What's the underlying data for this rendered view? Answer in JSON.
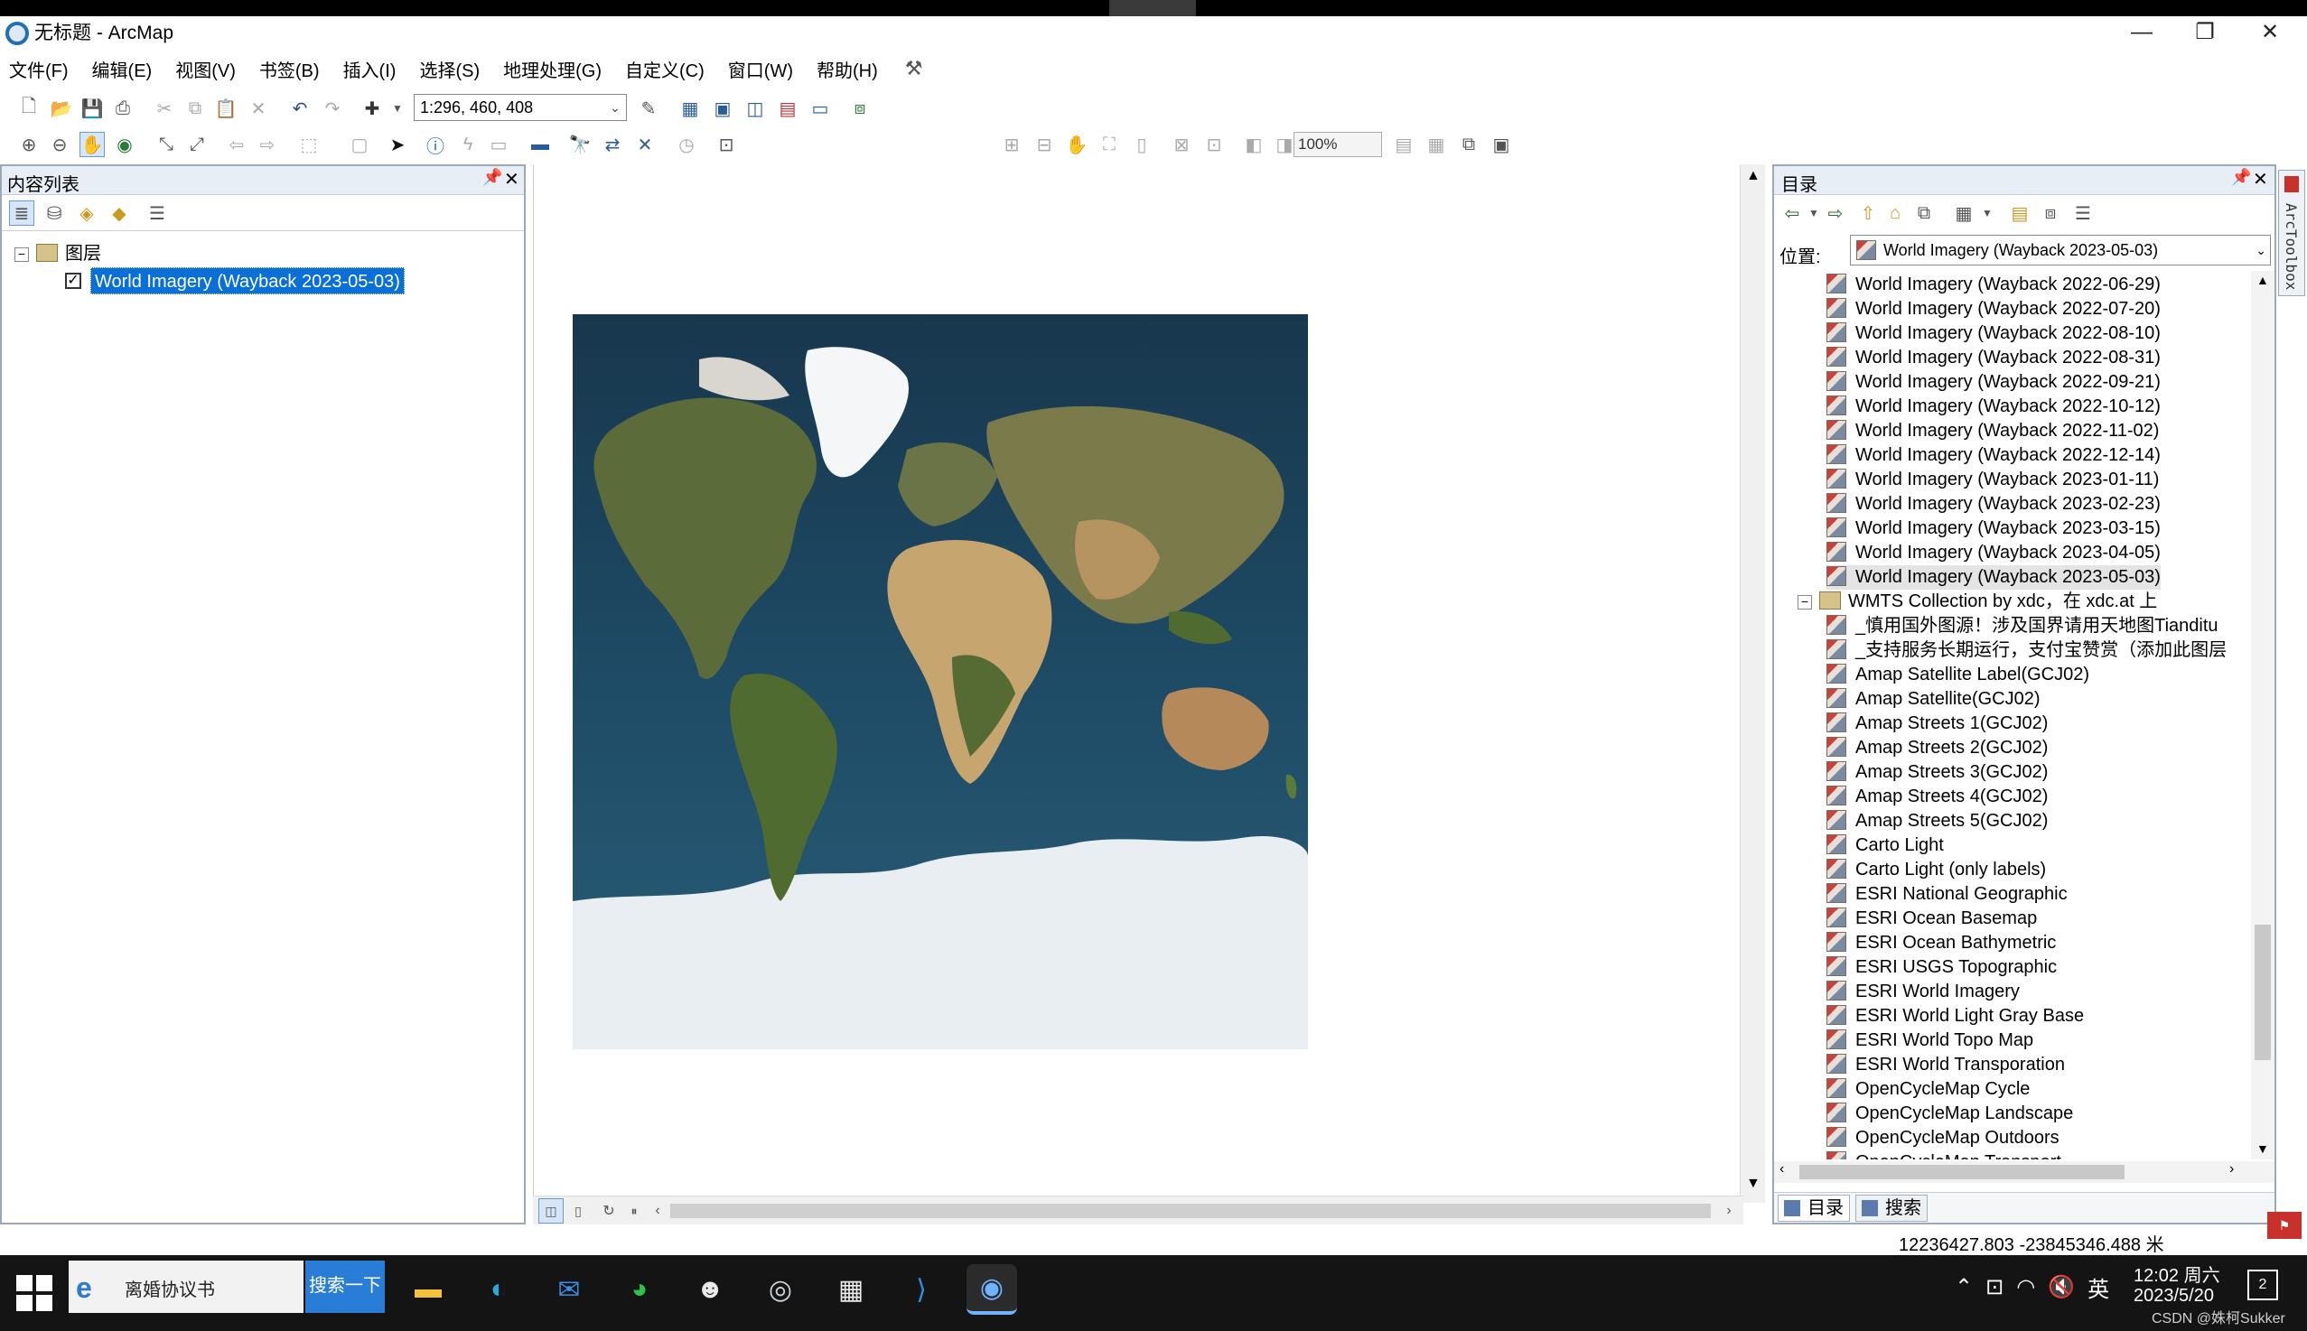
{
  "window": {
    "title": "无标题 - ArcMap",
    "collapse_glyph": "⌄",
    "min_glyph": "—",
    "max_glyph": "❐",
    "close_glyph": "✕"
  },
  "menu": [
    "文件(F)",
    "编辑(E)",
    "视图(V)",
    "书签(B)",
    "插入(I)",
    "选择(S)",
    "地理处理(G)",
    "自定义(C)",
    "窗口(W)",
    "帮助(H)"
  ],
  "toolbar": {
    "scale": "1:296, 460, 408",
    "zoom": "100%"
  },
  "toc": {
    "title": "内容列表",
    "layers_group": "图层",
    "layer_name": "World Imagery (Wayback 2023-05-03)",
    "layer_checked": true
  },
  "catalog": {
    "title": "目录",
    "location_label": "位置:",
    "location_value": "World Imagery (Wayback 2023-05-03)",
    "items": [
      "World Imagery (Wayback 2022-06-29)",
      "World Imagery (Wayback 2022-07-20)",
      "World Imagery (Wayback 2022-08-10)",
      "World Imagery (Wayback 2022-08-31)",
      "World Imagery (Wayback 2022-09-21)",
      "World Imagery (Wayback 2022-10-12)",
      "World Imagery (Wayback 2022-11-02)",
      "World Imagery (Wayback 2022-12-14)",
      "World Imagery (Wayback 2023-01-11)",
      "World Imagery (Wayback 2023-02-23)",
      "World Imagery (Wayback 2023-03-15)",
      "World Imagery (Wayback 2023-04-05)",
      "World Imagery (Wayback 2023-05-03)"
    ],
    "collection": "WMTS Collection by xdc，在 xdc.at 上",
    "collection_items": [
      "_慎用国外图源！涉及国界请用天地图Tianditu",
      "_支持服务长期运行，支付宝赞赏（添加此图层",
      "Amap Satellite Label(GCJ02)",
      "Amap Satellite(GCJ02)",
      "Amap Streets 1(GCJ02)",
      "Amap Streets 2(GCJ02)",
      "Amap Streets 3(GCJ02)",
      "Amap Streets 4(GCJ02)",
      "Amap Streets 5(GCJ02)",
      "Carto Light",
      "Carto Light (only labels)",
      "ESRI National Geographic",
      "ESRI Ocean Basemap",
      "ESRI Ocean Bathymetric",
      "ESRI USGS Topographic",
      "ESRI World Imagery",
      "ESRI World Light Gray Base",
      "ESRI World Topo Map",
      "ESRI World Transporation",
      "OpenCycleMap Cycle",
      "OpenCycleMap Landscape",
      "OpenCycleMap Outdoors",
      "OpenCycleMap Transport"
    ],
    "tab_catalog": "目录",
    "tab_search": "搜索"
  },
  "toolbox_label": "ArcToolbox",
  "status": {
    "coords": "12236427.803  -23845346.488 米"
  },
  "taskbar": {
    "search_text": "离婚协议书",
    "search_button": "搜索一下",
    "ime": "英",
    "time": "12:02 周六",
    "date": "2023/5/20",
    "notif_count": "2",
    "watermark": "CSDN @姝柯Sukker"
  }
}
